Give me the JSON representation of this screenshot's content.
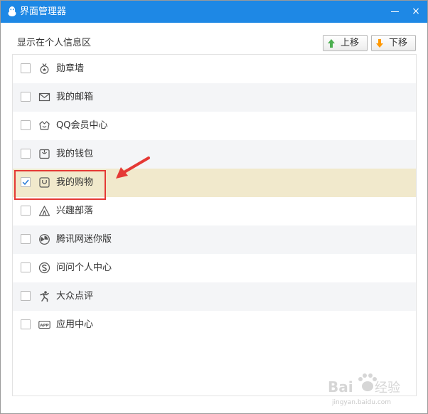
{
  "window": {
    "title": "界面管理器",
    "title_bar_color": "#1e88e5",
    "minimize_icon": "minimize-icon",
    "close_icon": "close-icon",
    "close_glyph": "×"
  },
  "section": {
    "label": "显示在个人信息区"
  },
  "toolbar": {
    "move_up_label": "上移",
    "move_up_icon": "arrow-up-icon",
    "move_up_icon_color": "#4caf50",
    "move_down_label": "下移",
    "move_down_icon": "arrow-down-icon",
    "move_down_icon_color": "#ff9800"
  },
  "items": [
    {
      "label": "勋章墙",
      "icon": "medal-icon",
      "checked": false
    },
    {
      "label": "我的邮箱",
      "icon": "mail-icon",
      "checked": false
    },
    {
      "label": "QQ会员中心",
      "icon": "crown-icon",
      "checked": false
    },
    {
      "label": "我的钱包",
      "icon": "wallet-icon",
      "checked": false
    },
    {
      "label": "我的购物",
      "icon": "shopping-bag-icon",
      "checked": true
    },
    {
      "label": "兴趣部落",
      "icon": "tent-icon",
      "checked": false
    },
    {
      "label": "腾讯网迷你版",
      "icon": "compass-icon",
      "checked": false
    },
    {
      "label": "问问个人中心",
      "icon": "s-circle-icon",
      "checked": false
    },
    {
      "label": "大众点评",
      "icon": "person-running-icon",
      "checked": false
    },
    {
      "label": "应用中心",
      "icon": "app-icon",
      "checked": false
    }
  ],
  "colors": {
    "selected_row": "#f1e9cc",
    "alt_row": "#f4f5f7",
    "highlight_box": "#e53935",
    "annotation_arrow": "#e53935"
  },
  "watermark": {
    "logo": "Bai du 经验",
    "url": "jingyan.baidu.com"
  }
}
